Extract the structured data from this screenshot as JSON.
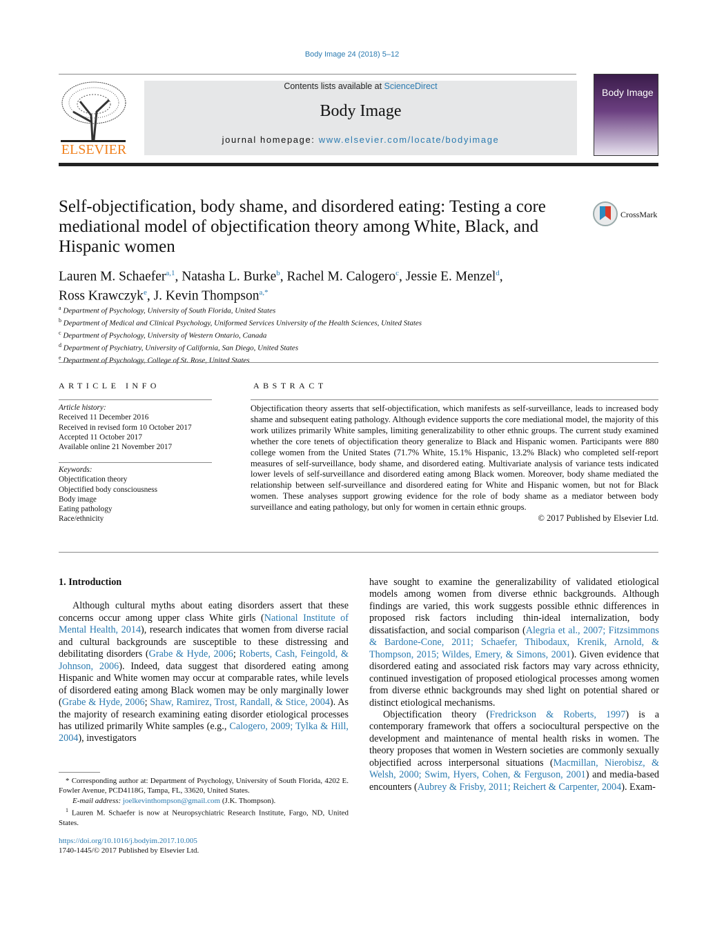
{
  "header": {
    "citation": "Body Image 24 (2018) 5–12",
    "contents_prefix": "Contents lists available at ",
    "contents_link": "ScienceDirect",
    "journal": "Body Image",
    "homepage_prefix": "journal homepage: ",
    "homepage_link": "www.elsevier.com/locate/bodyimage",
    "publisher_logo": "ELSEVIER",
    "cover_title": "Body Image",
    "crossmark": "CrossMark"
  },
  "colors": {
    "link": "#2a7ab0",
    "elsevier": "#f07f1b",
    "banner": "#e6e7e8"
  },
  "title": "Self-objectification, body shame, and disordered eating: Testing a core mediational model of objectification theory among White, Black, and Hispanic women",
  "authors": [
    {
      "name": "Lauren M. Schaefer",
      "sup": "a,1"
    },
    {
      "name": "Natasha L. Burke",
      "sup": "b"
    },
    {
      "name": "Rachel M. Calogero",
      "sup": "c"
    },
    {
      "name": "Jessie E. Menzel",
      "sup": "d"
    },
    {
      "name": "Ross Krawczyk",
      "sup": "e"
    },
    {
      "name": "J. Kevin Thompson",
      "sup": "a,*"
    }
  ],
  "affiliations": [
    {
      "key": "a",
      "text": "Department of Psychology, University of South Florida, United States"
    },
    {
      "key": "b",
      "text": "Department of Medical and Clinical Psychology, Uniformed Services University of the Health Sciences, United States"
    },
    {
      "key": "c",
      "text": "Department of Psychology, University of Western Ontario, Canada"
    },
    {
      "key": "d",
      "text": "Department of Psychiatry, University of California, San Diego, United States"
    },
    {
      "key": "e",
      "text": "Department of Psychology, College of St. Rose, United States"
    }
  ],
  "article_info": {
    "heading": "ARTICLE INFO",
    "history_label": "Article history:",
    "history": [
      "Received 11 December 2016",
      "Received in revised form 10 October 2017",
      "Accepted 11 October 2017",
      "Available online 21 November 2017"
    ],
    "keywords_label": "Keywords:",
    "keywords": [
      "Objectification theory",
      "Objectified body consciousness",
      "Body image",
      "Eating pathology",
      "Race/ethnicity"
    ]
  },
  "abstract": {
    "heading": "ABSTRACT",
    "text": "Objectification theory asserts that self-objectification, which manifests as self-surveillance, leads to increased body shame and subsequent eating pathology. Although evidence supports the core mediational model, the majority of this work utilizes primarily White samples, limiting generalizability to other ethnic groups. The current study examined whether the core tenets of objectification theory generalize to Black and Hispanic women. Participants were 880 college women from the United States (71.7% White, 15.1% Hispanic, 13.2% Black) who completed self-report measures of self-surveillance, body shame, and disordered eating. Multivariate analysis of variance tests indicated lower levels of self-surveillance and disordered eating among Black women. Moreover, body shame mediated the relationship between self-surveillance and disordered eating for White and Hispanic women, but not for Black women. These analyses support growing evidence for the role of body shame as a mediator between body surveillance and eating pathology, but only for women in certain ethnic groups.",
    "copyright": "© 2017 Published by Elsevier Ltd."
  },
  "section": {
    "heading": "1.  Introduction"
  },
  "left_paragraphs": [
    [
      {
        "t": "Although cultural myths about eating disorders assert that these concerns occur among upper class White girls ("
      },
      {
        "t": "National Institute of Mental Health, 2014",
        "link": true
      },
      {
        "t": "), research indicates that women from diverse racial and cultural backgrounds are susceptible to these distressing and debilitating disorders ("
      },
      {
        "t": "Grabe & Hyde, 2006",
        "link": true
      },
      {
        "t": "; "
      },
      {
        "t": "Roberts, Cash, Feingold, & Johnson, 2006",
        "link": true
      },
      {
        "t": "). Indeed, data suggest that disordered eating among Hispanic and White women may occur at comparable rates, while levels of disordered eating among Black women may be only marginally lower ("
      },
      {
        "t": "Grabe & Hyde, 2006",
        "link": true
      },
      {
        "t": "; "
      },
      {
        "t": "Shaw, Ramirez, Trost, Randall, & Stice, 2004",
        "link": true
      },
      {
        "t": "). As the majority of research examining eating disorder etiological processes has utilized primarily White samples (e.g., "
      },
      {
        "t": "Calogero, 2009; Tylka & Hill, 2004",
        "link": true
      },
      {
        "t": "), investigators"
      }
    ]
  ],
  "right_paragraphs": [
    [
      {
        "t": "have sought to examine the generalizability of validated etiological models among women from diverse ethnic backgrounds. Although findings are varied, this work suggests possible ethnic differences in proposed risk factors including thin-ideal internalization, body dissatisfaction, and social comparison ("
      },
      {
        "t": "Alegria et al., 2007; Fitzsimmons & Bardone-Cone, 2011; Schaefer, Thibodaux, Krenik, Arnold, & Thompson, 2015; Wildes, Emery, & Simons, 2001",
        "link": true
      },
      {
        "t": "). Given evidence that disordered eating and associated risk factors may vary across ethnicity, continued investigation of proposed etiological processes among women from diverse ethnic backgrounds may shed light on potential shared or distinct etiological mechanisms."
      }
    ],
    [
      {
        "t": "Objectification theory ("
      },
      {
        "t": "Fredrickson & Roberts, 1997",
        "link": true
      },
      {
        "t": ") is a contemporary framework that offers a sociocultural perspective on the development and maintenance of mental health risks in women. The theory proposes that women in Western societies are commonly sexually objectified across interpersonal situations ("
      },
      {
        "t": "Macmillan, Nierobisz, & Welsh, 2000; Swim, Hyers, Cohen, & Ferguson, 2001",
        "link": true
      },
      {
        "t": ") and media-based encounters ("
      },
      {
        "t": "Aubrey & Frisby, 2011; Reichert & Carpenter, 2004",
        "link": true
      },
      {
        "t": "). Exam-"
      }
    ]
  ],
  "footnotes": {
    "corresponding": "Corresponding author at: Department of Psychology, University of South Florida, 4202 E. Fowler Avenue, PCD4118G, Tampa, FL, 33620, United States.",
    "email_label": "E-mail address: ",
    "email": "joelkevinthompson@gmail.com",
    "email_suffix": " (J.K. Thompson).",
    "note1": "Lauren M. Schaefer is now at Neuropsychiatric Research Institute, Fargo, ND, United States.",
    "doi": "https://doi.org/10.1016/j.bodyim.2017.10.005",
    "issn": "1740-1445/© 2017 Published by Elsevier Ltd."
  }
}
